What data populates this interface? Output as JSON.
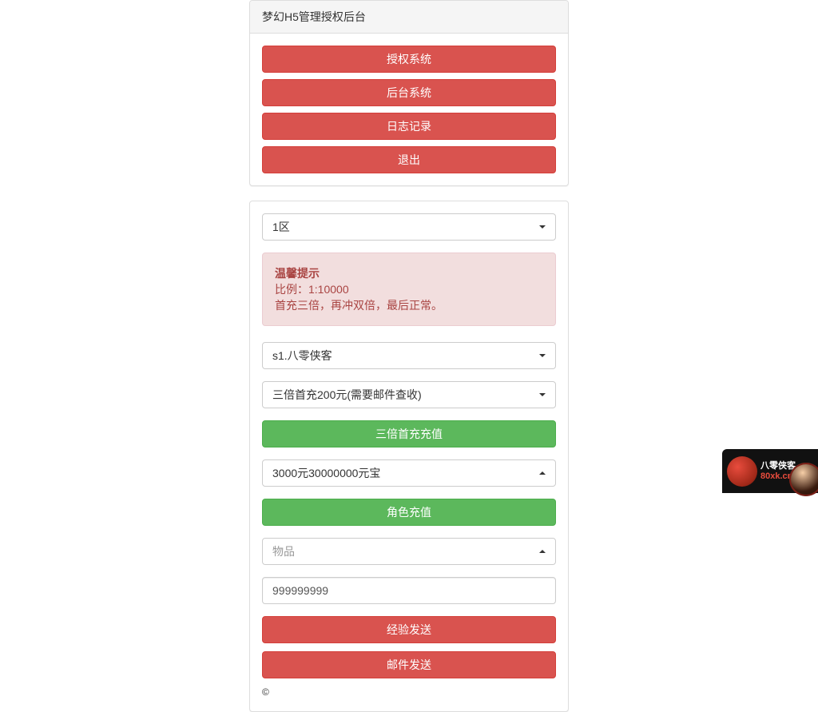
{
  "header": {
    "title": "梦幻H5管理授权后台",
    "nav": {
      "auth": "授权系统",
      "backend": "后台系统",
      "log": "日志记录",
      "exit": "退出"
    }
  },
  "zone": {
    "selected": "1区"
  },
  "tip": {
    "heading": "温馨提示",
    "line1": "比例：1:10000",
    "line2": "首充三倍，再冲双倍，最后正常。"
  },
  "form": {
    "player_selected": "s1.八零侠客",
    "package_selected": "三倍首充200元(需要邮件查收)",
    "btn_triple": "三倍首充充值",
    "amount_selected": "3000元30000000元宝",
    "btn_role_recharge": "角色充值",
    "item_placeholder": "物品",
    "exp_value": "999999999",
    "btn_exp_send": "经验发送",
    "btn_mail_send": "邮件发送"
  },
  "copyright": "©",
  "watermark": {
    "line1": "八零侠客",
    "line2": "80xk.cn"
  }
}
